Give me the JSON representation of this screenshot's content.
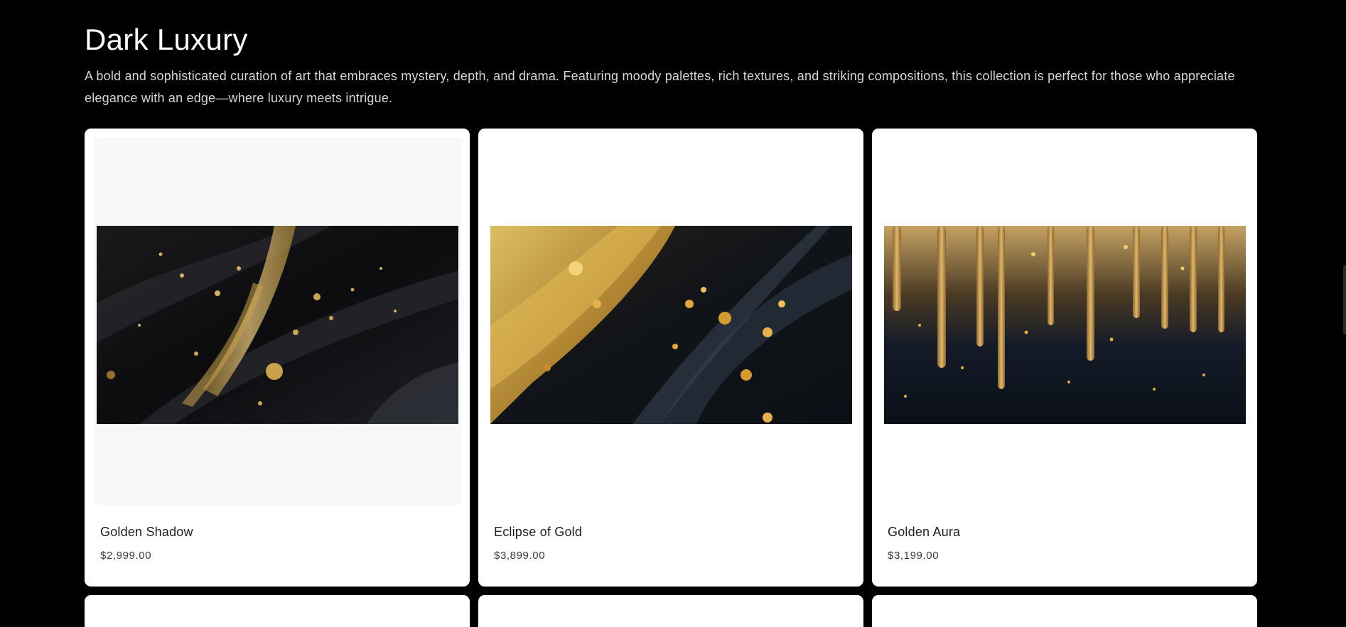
{
  "collection": {
    "title": "Dark Luxury",
    "description": "A bold and sophisticated curation of art that embraces mystery, depth, and drama. Featuring moody palettes, rich textures, and striking compositions, this collection is perfect for those who appreciate elegance with an edge—where luxury meets intrigue."
  },
  "products": [
    {
      "title": "Golden Shadow",
      "price": "$2,999.00",
      "image_icon": "golden-shadow-artwork"
    },
    {
      "title": "Eclipse of Gold",
      "price": "$3,899.00",
      "image_icon": "eclipse-of-gold-artwork"
    },
    {
      "title": "Golden Aura",
      "price": "$3,199.00",
      "image_icon": "golden-aura-artwork"
    }
  ],
  "colors": {
    "page_background": "#000000",
    "card_background": "#ffffff",
    "gold": "#c9a24a",
    "deep_black": "#0b0b0d",
    "navy_black": "#0d1420"
  }
}
